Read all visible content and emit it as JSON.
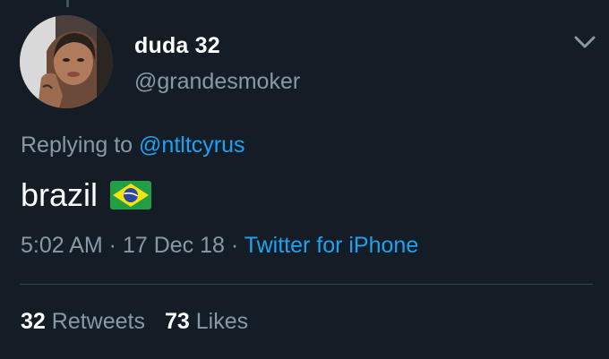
{
  "user": {
    "display_name": "duda 32",
    "handle": "@grandesmoker"
  },
  "reply": {
    "prefix": "Replying to",
    "mention": "@ntltcyrus"
  },
  "tweet": {
    "text": "brazil",
    "emoji": "brazil-flag-icon"
  },
  "meta": {
    "time": "5:02 AM",
    "separator": " · ",
    "date": "17 Dec 18",
    "source": "Twitter for iPhone"
  },
  "stats": {
    "retweets_count": "32",
    "retweets_label": "Retweets",
    "likes_count": "73",
    "likes_label": "Likes"
  },
  "colors": {
    "background": "#141d26",
    "secondary_text": "#8899a6",
    "accent": "#1da1f2",
    "divider": "#38444d"
  }
}
